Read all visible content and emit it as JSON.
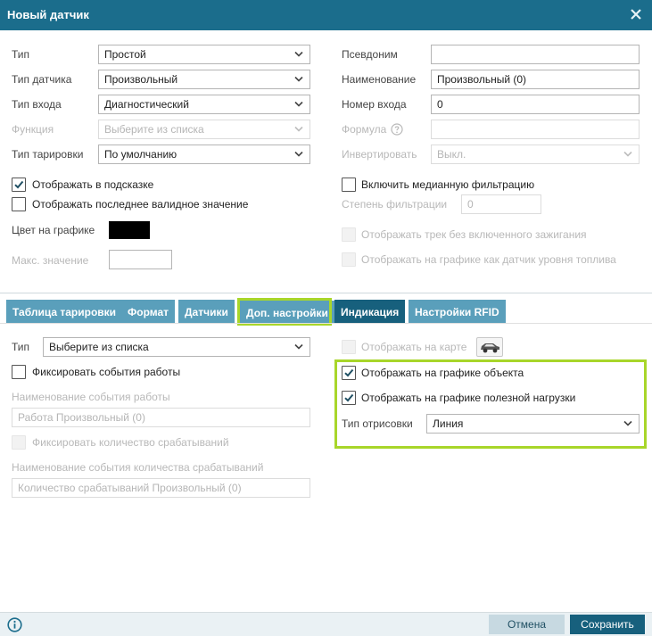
{
  "dialog": {
    "title": "Новый датчик"
  },
  "left_form": {
    "type": {
      "label": "Тип",
      "value": "Простой"
    },
    "sensor_type": {
      "label": "Тип датчика",
      "value": "Произвольный"
    },
    "input_type": {
      "label": "Тип входа",
      "value": "Диагностический"
    },
    "function": {
      "label": "Функция",
      "value": "Выберите из списка"
    },
    "calibration_type": {
      "label": "Тип тарировки",
      "value": "По умолчанию"
    },
    "show_in_tooltip": {
      "label": "Отображать в подсказке",
      "checked": true
    },
    "show_last_valid": {
      "label": "Отображать последнее валидное значение",
      "checked": false
    },
    "chart_color": {
      "label": "Цвет на графике",
      "color": "#000000"
    },
    "max_value": {
      "label": "Макс. значение",
      "value": ""
    }
  },
  "right_form": {
    "alias": {
      "label": "Псевдоним",
      "value": ""
    },
    "name": {
      "label": "Наименование",
      "value": "Произвольный (0)"
    },
    "input_number": {
      "label": "Номер входа",
      "value": "0"
    },
    "formula": {
      "label": "Формула",
      "value": ""
    },
    "invert": {
      "label": "Инвертировать",
      "value": "Выкл."
    },
    "median_filter": {
      "label": "Включить медианную фильтрацию",
      "checked": false
    },
    "filter_degree": {
      "label": "Степень фильтрации",
      "value": "0"
    },
    "track_no_ignition": {
      "label": "Отображать трек без включенного зажигания"
    },
    "fuel_level_chart": {
      "label": "Отображать на графике как датчик уровня топлива"
    }
  },
  "tabs": [
    {
      "label": "Таблица тарировки"
    },
    {
      "label": "Формат"
    },
    {
      "label": "Датчики"
    },
    {
      "label": "Доп. настройки"
    },
    {
      "label": "Индикация"
    },
    {
      "label": "Настройки RFID"
    }
  ],
  "tab_content": {
    "type": {
      "label": "Тип",
      "value": "Выберите из списка"
    },
    "log_work_events": {
      "label": "Фиксировать события работы",
      "checked": false
    },
    "work_event_name": {
      "label": "Наименование события работы",
      "value": "Работа Произвольный (0)"
    },
    "log_trigger_count": {
      "label": "Фиксировать количество срабатываний"
    },
    "trigger_event_name": {
      "label": "Наименование события количества срабатываний",
      "value": "Количество срабатываний Произвольный (0)"
    },
    "show_on_map": {
      "label": "Отображать на карте"
    },
    "show_on_object_chart": {
      "label": "Отображать на графике объекта",
      "checked": true
    },
    "show_on_payload_chart": {
      "label": "Отображать на графике полезной нагрузки",
      "checked": true
    },
    "draw_type": {
      "label": "Тип отрисовки",
      "value": "Линия"
    }
  },
  "footer": {
    "cancel_label": "Отмена",
    "save_label": "Сохранить"
  },
  "colors": {
    "header": "#1b6d8c",
    "tab": "#5a9fbb",
    "tab_active": "#17607d",
    "highlight": "#a8d62a"
  }
}
